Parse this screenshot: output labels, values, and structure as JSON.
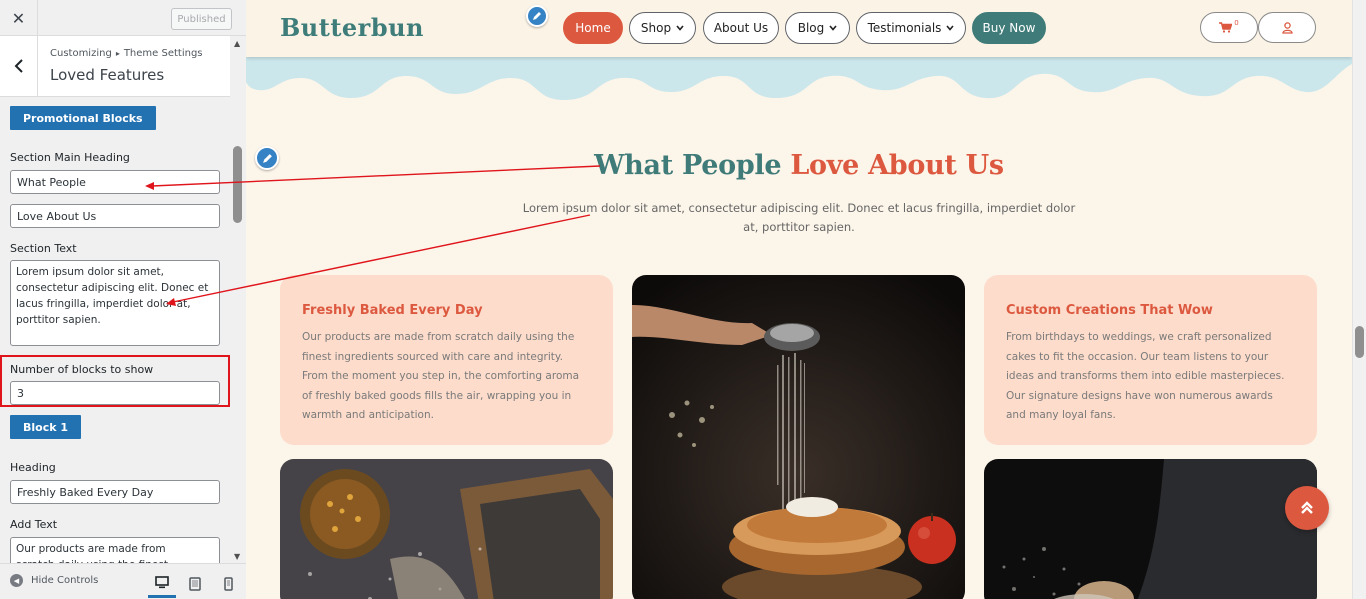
{
  "customizer": {
    "close_glyph": "✕",
    "published_label": "Published",
    "back_glyph": "‹",
    "breadcrumb_root": "Customizing",
    "breadcrumb_sep": "▸",
    "breadcrumb_parent": "Theme Settings",
    "panel_title": "Loved Features",
    "promotional_blocks_label": "Promotional Blocks",
    "section_main_heading_label": "Section Main Heading",
    "heading_part1_value": "What People",
    "heading_part2_value": "Love About Us",
    "section_text_label": "Section Text",
    "section_text_value": "Lorem ipsum dolor sit amet, consectetur adipiscing elit. Donec et lacus fringilla, imperdiet dolor at, porttitor sapien.",
    "blocks_count_label": "Number of blocks to show",
    "blocks_count_value": "3",
    "block1_label": "Block 1",
    "heading_label": "Heading",
    "heading_value": "Freshly Baked Every Day",
    "add_text_label": "Add Text",
    "add_text_value": "Our products are made from scratch daily using the finest ingredients",
    "hide_controls_label": "Hide Controls"
  },
  "site": {
    "logo_text": "Butterbun",
    "nav": {
      "home": "Home",
      "shop": "Shop",
      "about": "About Us",
      "blog": "Blog",
      "testimonials": "Testimonials",
      "buy_now": "Buy Now"
    },
    "cart_count": "0",
    "section": {
      "heading_part1": "What People",
      "heading_part2": "Love About Us",
      "text": "Lorem ipsum dolor sit amet, consectetur adipiscing elit. Donec et lacus fringilla, imperdiet dolor at, porttitor sapien."
    },
    "cards": [
      {
        "title": "Freshly Baked Every Day",
        "body": "Our products are made from scratch daily using the finest ingredients sourced with care and integrity. From the moment you step in, the comforting aroma of freshly baked goods fills the air, wrapping you in warmth and anticipation."
      },
      {
        "title": "Custom Creations That Wow",
        "body": "From birthdays to weddings, we craft personalized cakes to fit the occasion. Our team listens to your ideas and transforms them into edible masterpieces. Our signature designs have won numerous awards and many loyal fans."
      }
    ]
  },
  "colors": {
    "accent_red": "#dc5940",
    "accent_teal": "#3f7b78",
    "wp_blue": "#2271b1",
    "annotation_red": "#e0141b",
    "card_peach": "#fddccb",
    "drip_blue": "#cbe7ec"
  },
  "icons": {
    "edit": "pencil-icon",
    "cart": "cart-icon",
    "user": "user-icon",
    "scroll_top": "double-chevron-up-icon"
  }
}
